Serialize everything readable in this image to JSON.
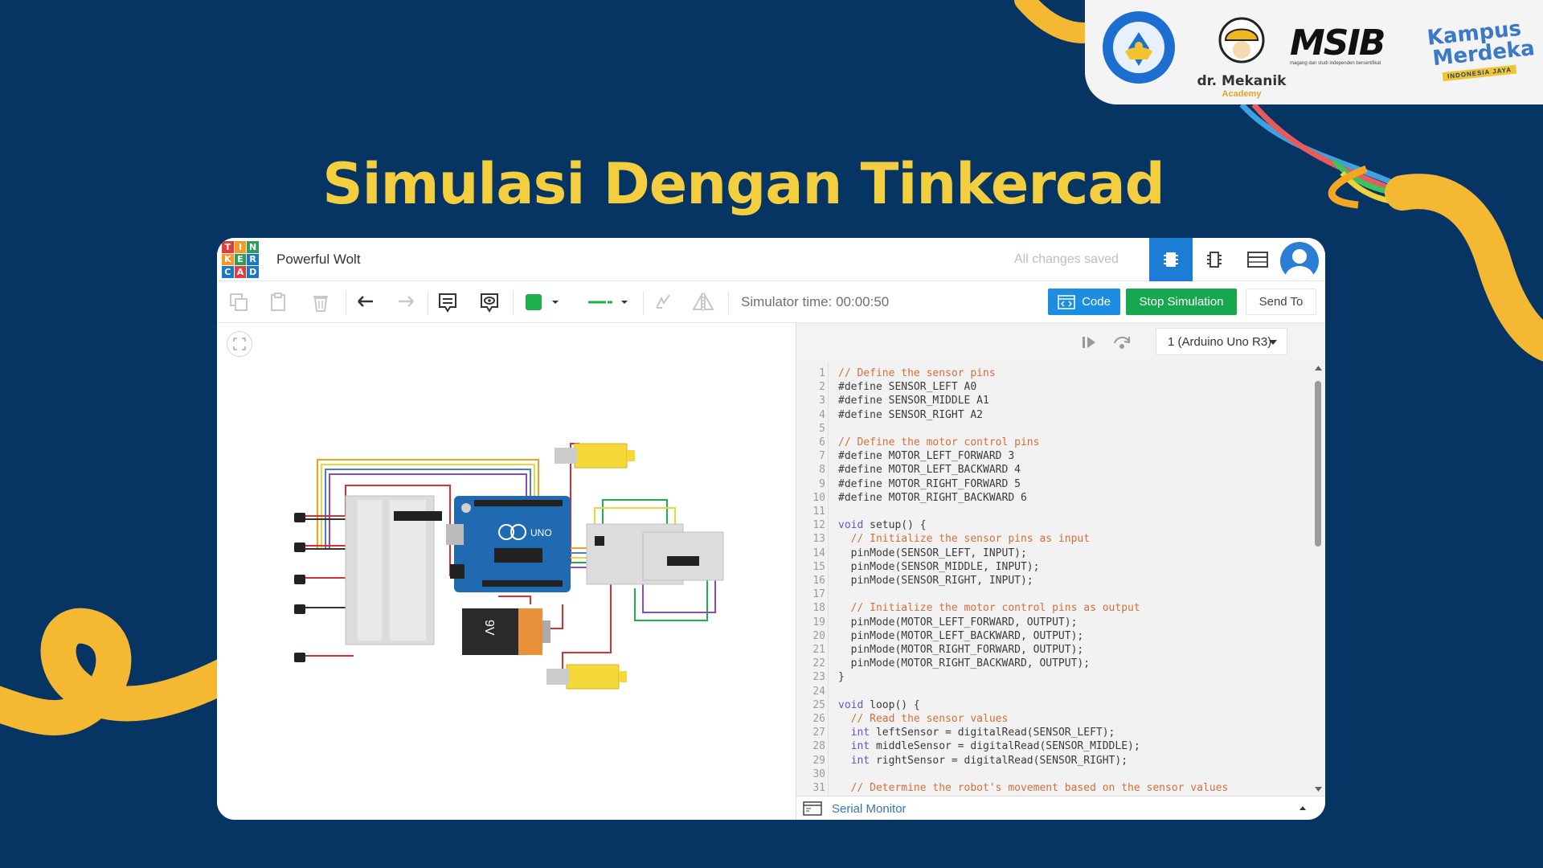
{
  "slide": {
    "title": "Simulasi Dengan Tinkercad"
  },
  "logos": {
    "tut_wuri": "TUT WURI HANDAYANI",
    "mekanik_name": "dr. Mekanik",
    "mekanik_sub": "Academy",
    "msib": "MSIB",
    "msib_sub": "magang dan studi independen bersertifikat",
    "kampus_line1": "Kampus",
    "kampus_line2": "Merdeka",
    "kampus_line3": "INDONESIA JAYA"
  },
  "app": {
    "logo_letters": [
      "T",
      "I",
      "N",
      "K",
      "E",
      "R",
      "C",
      "A",
      "D"
    ],
    "logo_colors": [
      "#e23c3c",
      "#f49a2a",
      "#2f9c5c",
      "#f49a2a",
      "#2f9c5c",
      "#1a77c9",
      "#1a77c9",
      "#e23c3c",
      "#1a77c9"
    ],
    "project_name": "Powerful Wolt",
    "save_status": "All changes saved"
  },
  "toolbar": {
    "simulator_time": "Simulator time: 00:00:50",
    "code_label": "Code",
    "stop_label": "Stop Simulation",
    "send_label": "Send To",
    "fill_color": "#1fb04e"
  },
  "editor": {
    "device": "1 (Arduino Uno R3)",
    "serial_monitor": "Serial Monitor",
    "lines": [
      {
        "n": "1",
        "t": "// Define the sensor pins",
        "k": "cmt"
      },
      {
        "n": "2",
        "t": "#define SENSOR_LEFT A0",
        "k": ""
      },
      {
        "n": "3",
        "t": "#define SENSOR_MIDDLE A1",
        "k": ""
      },
      {
        "n": "4",
        "t": "#define SENSOR_RIGHT A2",
        "k": ""
      },
      {
        "n": "5",
        "t": "",
        "k": ""
      },
      {
        "n": "6",
        "t": "// Define the motor control pins",
        "k": "cmt"
      },
      {
        "n": "7",
        "t": "#define MOTOR_LEFT_FORWARD 3",
        "k": ""
      },
      {
        "n": "8",
        "t": "#define MOTOR_LEFT_BACKWARD 4",
        "k": ""
      },
      {
        "n": "9",
        "t": "#define MOTOR_RIGHT_FORWARD 5",
        "k": ""
      },
      {
        "n": "10",
        "t": "#define MOTOR_RIGHT_BACKWARD 6",
        "k": ""
      },
      {
        "n": "11",
        "t": "",
        "k": ""
      },
      {
        "n": "12",
        "t": "void setup() {",
        "k": "kw"
      },
      {
        "n": "13",
        "t": "  // Initialize the sensor pins as input",
        "k": "cmt"
      },
      {
        "n": "14",
        "t": "  pinMode(SENSOR_LEFT, INPUT);",
        "k": ""
      },
      {
        "n": "15",
        "t": "  pinMode(SENSOR_MIDDLE, INPUT);",
        "k": ""
      },
      {
        "n": "16",
        "t": "  pinMode(SENSOR_RIGHT, INPUT);",
        "k": ""
      },
      {
        "n": "17",
        "t": "",
        "k": ""
      },
      {
        "n": "18",
        "t": "  // Initialize the motor control pins as output",
        "k": "cmt"
      },
      {
        "n": "19",
        "t": "  pinMode(MOTOR_LEFT_FORWARD, OUTPUT);",
        "k": ""
      },
      {
        "n": "20",
        "t": "  pinMode(MOTOR_LEFT_BACKWARD, OUTPUT);",
        "k": ""
      },
      {
        "n": "21",
        "t": "  pinMode(MOTOR_RIGHT_FORWARD, OUTPUT);",
        "k": ""
      },
      {
        "n": "22",
        "t": "  pinMode(MOTOR_RIGHT_BACKWARD, OUTPUT);",
        "k": ""
      },
      {
        "n": "23",
        "t": "}",
        "k": ""
      },
      {
        "n": "24",
        "t": "",
        "k": ""
      },
      {
        "n": "25",
        "t": "void loop() {",
        "k": "kw"
      },
      {
        "n": "26",
        "t": "  // Read the sensor values",
        "k": "cmt"
      },
      {
        "n": "27",
        "t": "  int leftSensor = digitalRead(SENSOR_LEFT);",
        "k": "int"
      },
      {
        "n": "28",
        "t": "  int middleSensor = digitalRead(SENSOR_MIDDLE);",
        "k": "int"
      },
      {
        "n": "29",
        "t": "  int rightSensor = digitalRead(SENSOR_RIGHT);",
        "k": "int"
      },
      {
        "n": "30",
        "t": "",
        "k": ""
      },
      {
        "n": "31",
        "t": "  // Determine the robot's movement based on the sensor values",
        "k": "cmt"
      }
    ]
  },
  "circuit": {
    "battery_label": "9V",
    "board_label": "UNO"
  }
}
